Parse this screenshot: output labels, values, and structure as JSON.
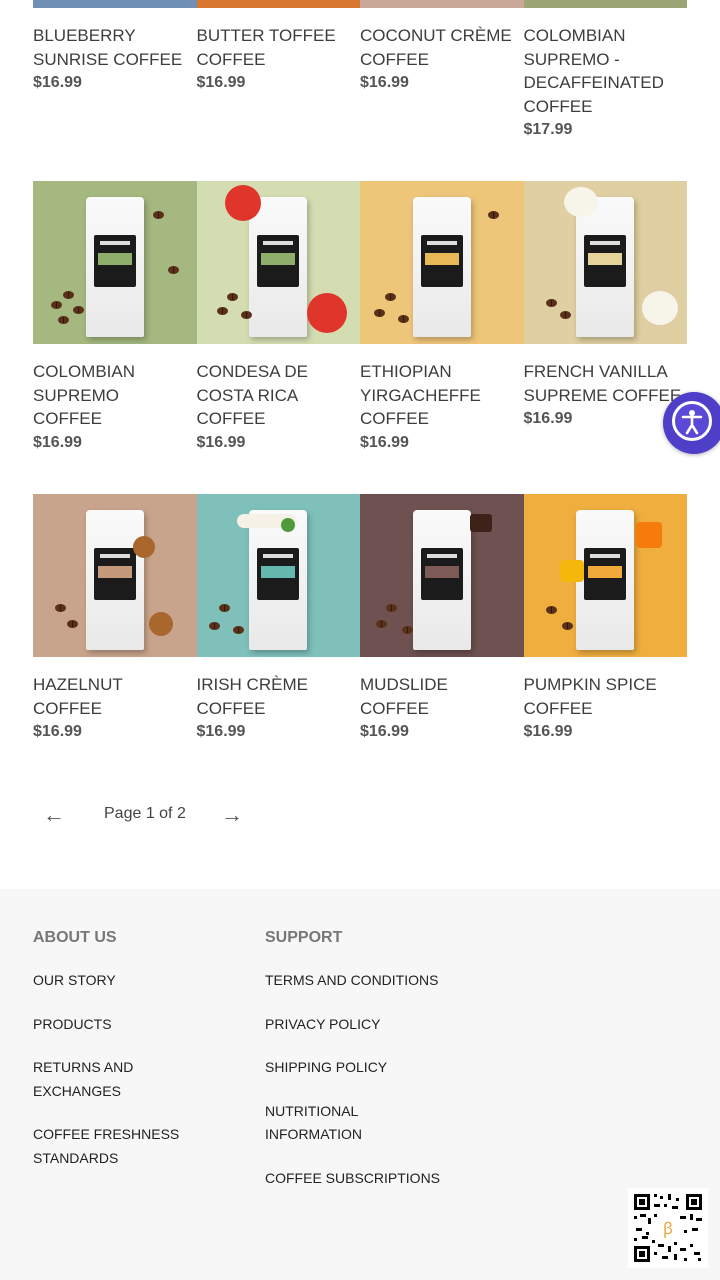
{
  "products": [
    [
      {
        "name": "BLUEBERRY SUNRISE COFFEE",
        "price": "$16.99",
        "bg": "#6f8fb5",
        "label": "#5d7fb5"
      },
      {
        "name": "BUTTER TOFFEE COFFEE",
        "price": "$16.99",
        "bg": "#d9792f",
        "label": "#d9792f"
      },
      {
        "name": "COCONUT CRÈME COFFEE",
        "price": "$16.99",
        "bg": "#c9a89a",
        "label": "#c9a89a"
      },
      {
        "name": "COLOMBIAN SUPREMO - DECAFFEINATED COFFEE",
        "price": "$17.99",
        "bg": "#9aa474",
        "label": "#9aa474"
      }
    ],
    [
      {
        "name": "COLOMBIAN SUPREMO COFFEE",
        "price": "$16.99",
        "bg": "#a5b87f",
        "label": "#8fae6a"
      },
      {
        "name": "CONDESA DE COSTA RICA COFFEE",
        "price": "$16.99",
        "bg": "#d4ddb2",
        "label": "#8fae6a"
      },
      {
        "name": "ETHIOPIAN YIRGACHEFFE COFFEE",
        "price": "$16.99",
        "bg": "#eec67a",
        "label": "#e8b957"
      },
      {
        "name": "FRENCH VANILLA SUPREME COFFEE",
        "price": "$16.99",
        "bg": "#e0cfa2",
        "label": "#e6d39a"
      }
    ],
    [
      {
        "name": "HAZELNUT COFFEE",
        "price": "$16.99",
        "bg": "#c9a48c",
        "label": "#c49a7a"
      },
      {
        "name": "IRISH CRÈME COFFEE",
        "price": "$16.99",
        "bg": "#7fc0bb",
        "label": "#64b8ad"
      },
      {
        "name": "MUDSLIDE COFFEE",
        "price": "$16.99",
        "bg": "#6e5150",
        "label": "#7d5a55"
      },
      {
        "name": "PUMPKIN SPICE COFFEE",
        "price": "$16.99",
        "bg": "#efae3e",
        "label": "#f2a93b"
      }
    ]
  ],
  "pagination": {
    "prev": "←",
    "next": "→",
    "text": "Page 1 of 2"
  },
  "footer": {
    "about": {
      "heading": "ABOUT US",
      "links": [
        "OUR STORY",
        "PRODUCTS",
        "RETURNS AND EXCHANGES",
        "COFFEE FRESHNESS STANDARDS"
      ]
    },
    "support": {
      "heading": "SUPPORT",
      "links": [
        "TERMS AND CONDITIONS",
        "PRIVACY POLICY",
        "SHIPPING POLICY",
        "NUTRITIONAL INFORMATION",
        "COFFEE SUBSCRIPTIONS"
      ]
    }
  },
  "icons": {
    "accessibility": "accessibility-icon",
    "qr": "qr-code-icon"
  }
}
